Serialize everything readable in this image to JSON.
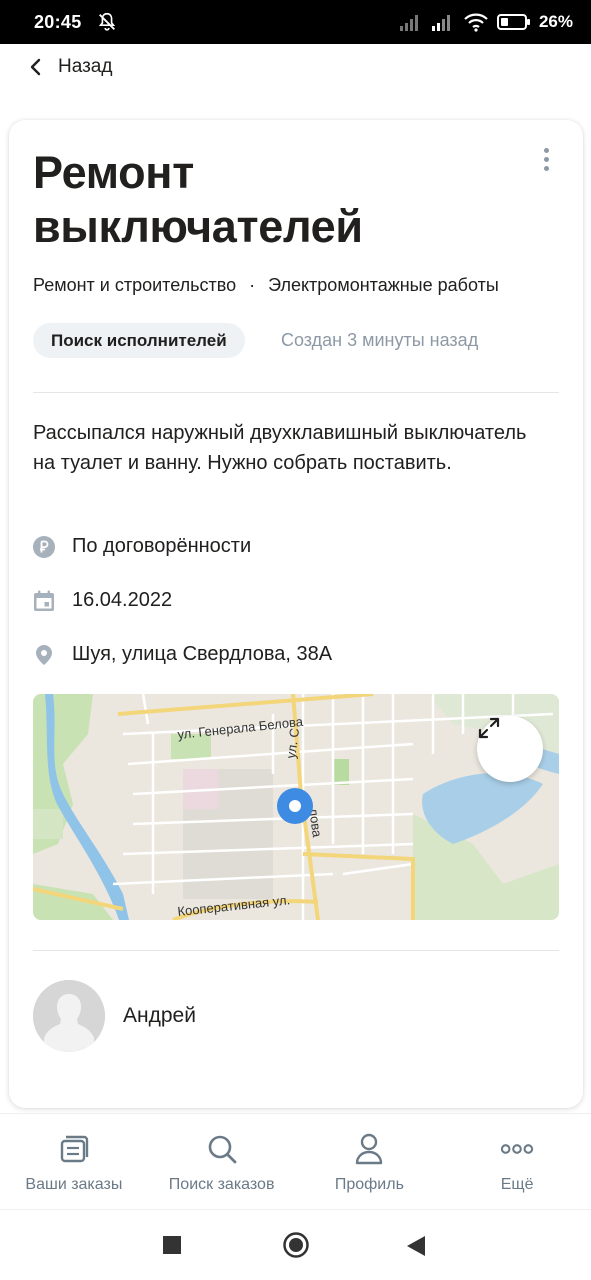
{
  "status_bar": {
    "time": "20:45",
    "battery": "26%"
  },
  "nav": {
    "back_label": "Назад"
  },
  "order": {
    "title": "Ремонт выключателей",
    "category": "Ремонт и строительство",
    "separator": "·",
    "subcategory": "Электромонтажные работы",
    "status_badge": "Поиск исполнителей",
    "created": "Создан 3 минуты назад",
    "description": "Рассыпался наружный двухклавишный выключатель на туалет и ванну. Нужно собрать поставить.",
    "price": "По договорённости",
    "date": "16.04.2022",
    "address": "Шуя, улица Свердлова, 38А"
  },
  "map": {
    "street_1": "ул. Генерала Белова",
    "street_2": "ул. С",
    "street_3": "лова",
    "street_4": "Кооперативная ул."
  },
  "author": {
    "name": "Андрей"
  },
  "tabs": [
    {
      "label": "Ваши заказы",
      "icon": "orders-icon"
    },
    {
      "label": "Поиск заказов",
      "icon": "search-icon"
    },
    {
      "label": "Профиль",
      "icon": "profile-icon"
    },
    {
      "label": "Ещё",
      "icon": "more-icon"
    }
  ],
  "colors": {
    "accent_blue": "#3d8be2",
    "muted_text": "#8d99a4",
    "pill_bg": "#eef2f5"
  }
}
